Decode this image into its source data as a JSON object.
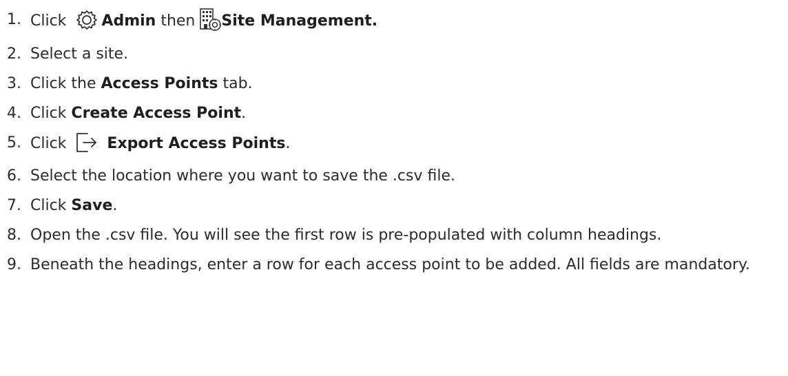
{
  "steps": [
    {
      "number": "1.",
      "click": "Click",
      "admin_label": "Admin",
      "then": "then",
      "site_management_label": "Site Management."
    },
    {
      "number": "2.",
      "text": "Select a site."
    },
    {
      "number": "3.",
      "prefix": "Click the",
      "bold": "Access Points",
      "suffix": "tab."
    },
    {
      "number": "4.",
      "prefix": "Click",
      "bold": "Create Access Point",
      "suffix": "."
    },
    {
      "number": "5.",
      "prefix": "Click",
      "bold": "Export Access Points",
      "suffix": "."
    },
    {
      "number": "6.",
      "text": "Select the location where you want to save the .csv file."
    },
    {
      "number": "7.",
      "prefix": "Click",
      "bold": "Save",
      "suffix": "."
    },
    {
      "number": "8.",
      "text": "Open the .csv file. You will see the first row is pre-populated with column headings."
    },
    {
      "number": "9.",
      "text": "Beneath the headings, enter a row for each access point to be added. All fields are mandatory."
    }
  ],
  "icons": {
    "admin": "gear-icon",
    "site_management": "building-gear-icon",
    "export": "export-arrow-icon"
  }
}
